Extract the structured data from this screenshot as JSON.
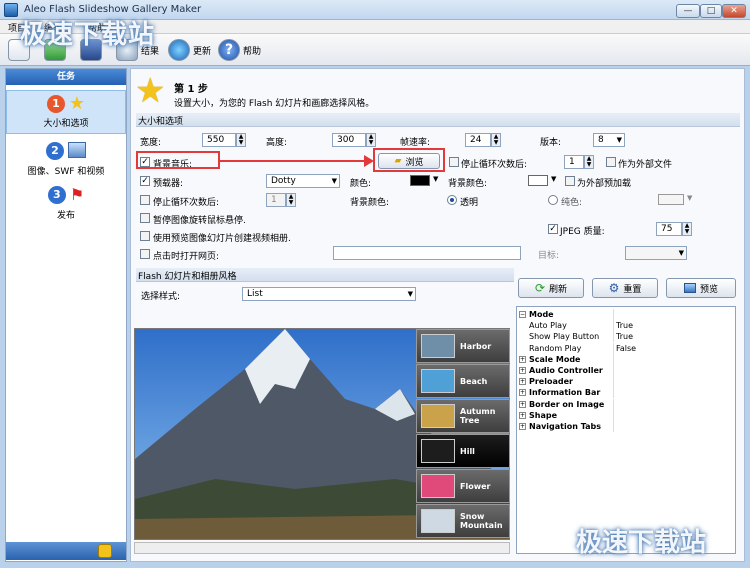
{
  "window": {
    "title": "Aleo Flash Slideshow Gallery Maker",
    "min": "—",
    "max": "□",
    "close": "✕"
  },
  "menu": {
    "items": [
      "项目",
      "编辑",
      "帮助"
    ]
  },
  "toolbar": {
    "result": "结果",
    "update": "更新",
    "help": "帮助"
  },
  "tasks": {
    "header": "任务",
    "items": [
      {
        "num": "1",
        "label": "大小和选项"
      },
      {
        "num": "2",
        "label": "图像、SWF 和视频"
      },
      {
        "num": "3",
        "label": "发布"
      }
    ]
  },
  "step": {
    "title": "第 1 步",
    "desc": "设置大小，为您的 Flash 幻灯片和画廊选择风格。"
  },
  "size_section": {
    "title": "大小和选项",
    "width_label": "宽度:",
    "width": "550",
    "height_label": "高度:",
    "height": "300",
    "fps_label": "帧速率:",
    "fps": "24",
    "version_label": "版本:",
    "version": "8",
    "bgmusic_label": "背景音乐:",
    "browse": "浏览",
    "stoploop_label": "停止循环次数后:",
    "stoploop": "1",
    "external_label": "作为外部文件",
    "preloader_label": "预载器:",
    "preloader": "Dotty",
    "color_label": "颜色:",
    "bgcolor_label": "背景颜色:",
    "external_preload": "为外部预加载",
    "stoploop2_label": "停止循环次数后:",
    "stoploop2": "1",
    "bgcolor2_label": "背景颜色:",
    "transparent": "透明",
    "solid": "纯色:",
    "pause_label": "暂停图像旋转鼠标悬停.",
    "jpeg_label": "JPEG 质量:",
    "jpeg": "75",
    "video_label": "使用预览图像幻灯片创建视频相册.",
    "openweb_label": "点击时打开网页:",
    "target_label": "目标:"
  },
  "style_section": {
    "title": "Flash 幻灯片和相册风格",
    "select_label": "选择样式:",
    "style": "List"
  },
  "buttons": {
    "refresh": "刷新",
    "reset": "重置",
    "preview": "预览"
  },
  "thumbs": [
    "Harbor",
    "Beach",
    "Autumn Tree",
    "Hill",
    "Flower",
    "Snow Mountain"
  ],
  "props": [
    {
      "type": "group",
      "open": true,
      "name": "Mode"
    },
    {
      "type": "prop",
      "name": "Auto Play",
      "value": "True"
    },
    {
      "type": "prop",
      "name": "Show Play Button",
      "value": "True"
    },
    {
      "type": "prop",
      "name": "Random Play",
      "value": "False"
    },
    {
      "type": "group",
      "open": false,
      "name": "Scale Mode"
    },
    {
      "type": "group",
      "open": false,
      "name": "Audio Controller"
    },
    {
      "type": "group",
      "open": false,
      "name": "Preloader"
    },
    {
      "type": "group",
      "open": false,
      "name": "Information Bar"
    },
    {
      "type": "group",
      "open": false,
      "name": "Border on Image"
    },
    {
      "type": "group",
      "open": false,
      "name": "Shape"
    },
    {
      "type": "group",
      "open": false,
      "name": "Navigation Tabs"
    }
  ],
  "watermark": "极速下载站",
  "colors": {
    "accent": "#2461b3",
    "highlight": "#e23a3a"
  }
}
